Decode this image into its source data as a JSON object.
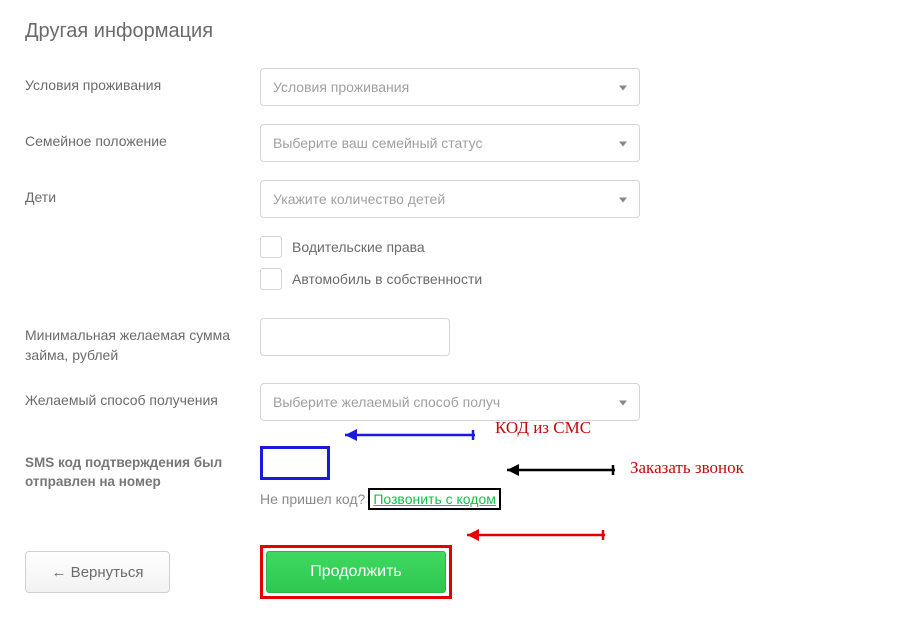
{
  "section_title": "Другая информация",
  "fields": {
    "living": {
      "label": "Условия проживания",
      "placeholder": "Условия проживания"
    },
    "marital": {
      "label": "Семейное положение",
      "placeholder": "Выберите ваш семейный статус"
    },
    "children": {
      "label": "Дети",
      "placeholder": "Укажите количество детей"
    },
    "drivers_license": {
      "label": "Водительские права"
    },
    "car_owned": {
      "label": "Автомобиль в собственности"
    },
    "min_loan": {
      "label": "Минимальная желаемая сумма займа, рублей"
    },
    "receive_method": {
      "label": "Желаемый способ получения",
      "placeholder": "Выберите желаемый способ получ"
    },
    "sms": {
      "label": "SMS код подтверждения был отправлен на номер",
      "help_text": "Не пришел код?",
      "call_link": "Позвонить с кодом"
    }
  },
  "buttons": {
    "back": "← Вернуться",
    "continue": "Продолжить"
  },
  "annotations": {
    "sms_code": "КОД из СМС",
    "order_call": "Заказать звонок"
  }
}
